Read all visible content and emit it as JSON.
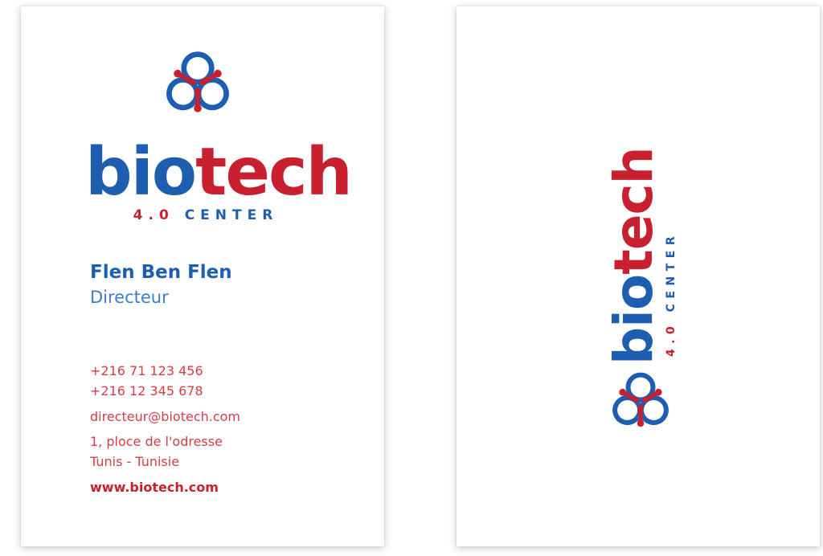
{
  "colors": {
    "blue": "#1d5eb0",
    "blue_light": "#3f7dcc",
    "red": "#c8202e",
    "red_light": "#d43e49"
  },
  "icons": {
    "logo": "biotech-flower-logo-icon"
  },
  "brand": {
    "word_blue": "bio",
    "word_red": "tech",
    "tag_red": "4.0 ",
    "tag_blue": "CENTER"
  },
  "person": {
    "name": "Flen Ben Flen",
    "title": "Directeur"
  },
  "contact": {
    "phone_1": "+216 71 123 456",
    "phone_2": "+216 12 345 678",
    "email": "directeur@biotech.com",
    "address_1": "1, ploce de l'odresse",
    "address_2": "Tunis - Tunisie",
    "website": "www.biotech.com"
  }
}
